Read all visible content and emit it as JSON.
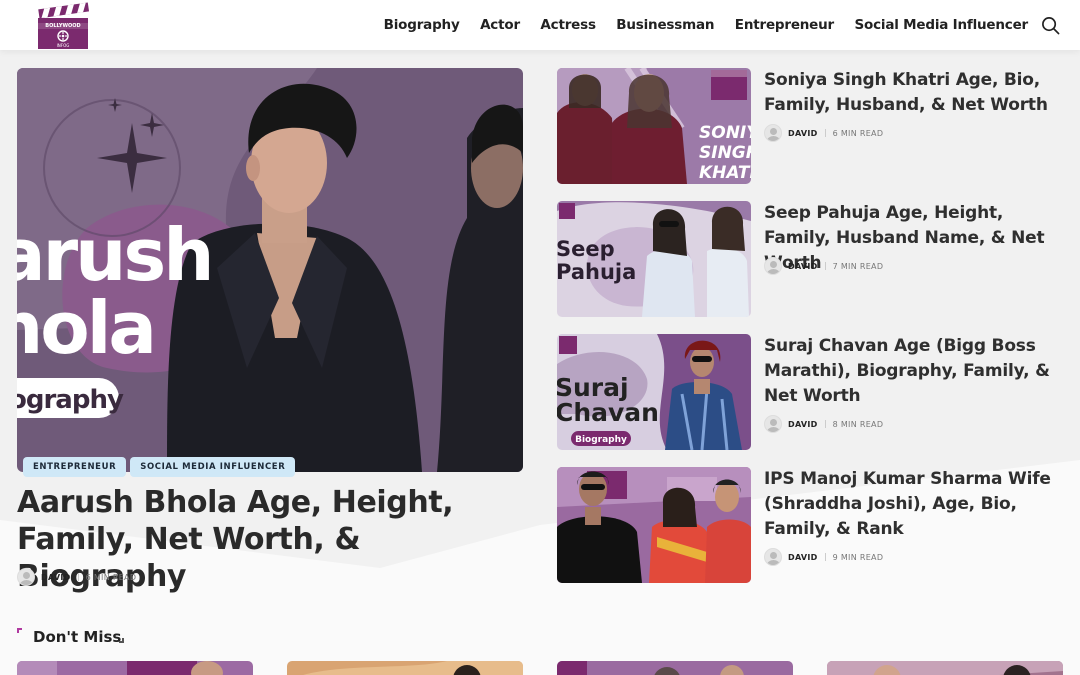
{
  "site": {
    "logo_text_top": "BOLLYWOOD",
    "logo_text_bottom": "INFOG"
  },
  "nav": {
    "items": [
      "Biography",
      "Actor",
      "Actress",
      "Businessman",
      "Entrepreneur",
      "Social Media Influencer"
    ]
  },
  "hero": {
    "image_text": [
      "arush",
      "hola",
      "ography"
    ],
    "tags": [
      "ENTREPRENEUR",
      "SOCIAL MEDIA INFLUENCER"
    ],
    "title": "Aarush Bhola Age, Height, Family, Net Worth, & Biography",
    "author": "DAVID",
    "read_time": "6 MIN READ"
  },
  "posts": [
    {
      "title": "Soniya Singh Khatri Age, Bio, Family, Husband, & Net Worth",
      "author": "DAVID",
      "read_time": "6 MIN READ",
      "thumb_text": [
        "SONIYA",
        "SINGH",
        "KHATRI"
      ]
    },
    {
      "title": "Seep Pahuja Age, Height, Family, Husband Name, & Net Worth",
      "author": "DAVID",
      "read_time": "7 MIN READ",
      "thumb_text": [
        "Seep",
        "Pahuja"
      ]
    },
    {
      "title": "Suraj Chavan Age (Bigg Boss Marathi), Biography, Family, & Net Worth",
      "author": "DAVID",
      "read_time": "8 MIN READ",
      "thumb_text": [
        "Suraj",
        "Chavan",
        "Biography"
      ]
    },
    {
      "title": "IPS Manoj Kumar Sharma Wife (Shraddha Joshi), Age, Bio, Family, & Rank",
      "author": "DAVID",
      "read_time": "9 MIN READ",
      "thumb_text": []
    }
  ],
  "dont_miss": {
    "label": "Don't Miss"
  },
  "colors": {
    "brand": "#7b2a6e",
    "tag_bg": "#cfe8f7",
    "accent_corner": "#b03aa0"
  }
}
